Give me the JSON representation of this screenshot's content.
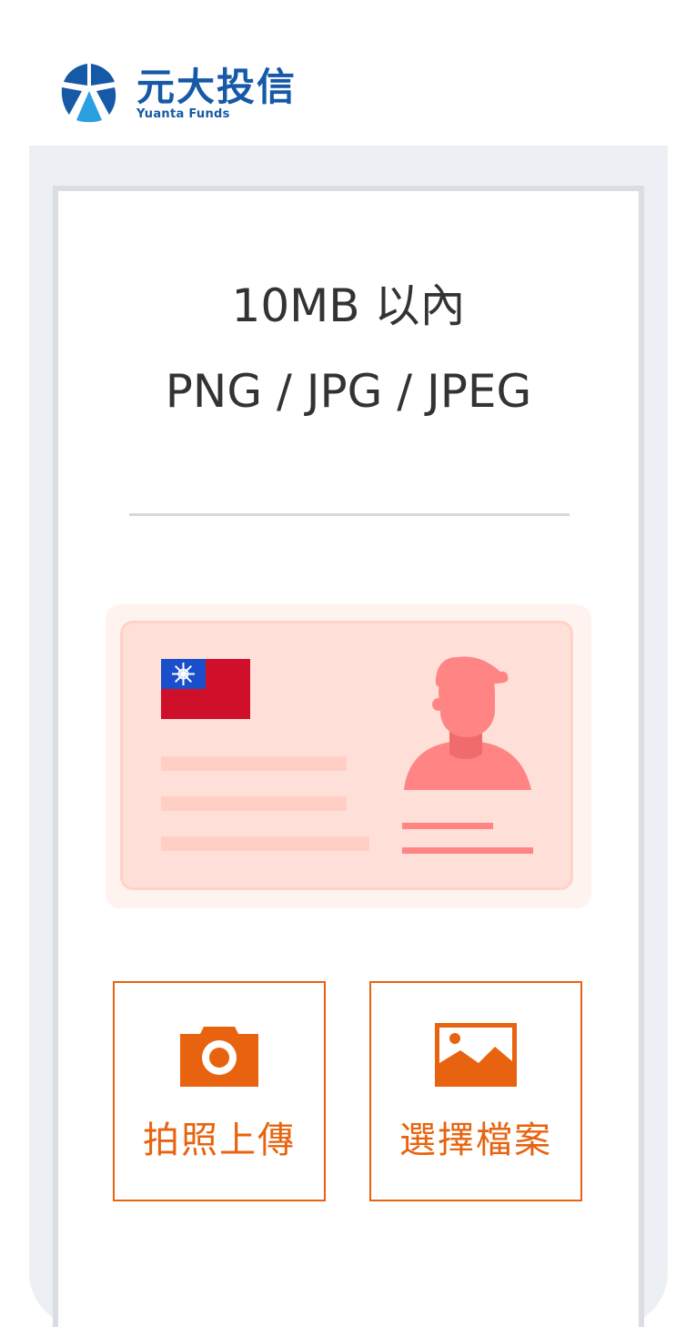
{
  "brand": {
    "name_cn": "元大投信",
    "name_en": "Yuanta Funds",
    "color": "#1659a6",
    "icon": "yuanta-logo-icon"
  },
  "upload": {
    "size_limit": "10MB 以內",
    "file_types": "PNG / JPG / JPEG",
    "id_card_illustration": {
      "icon": "id-card-icon",
      "flag_icon": "taiwan-flag-icon",
      "avatar_icon": "person-avatar-icon"
    }
  },
  "actions": {
    "camera": {
      "label": "拍照上傳",
      "icon": "camera-icon"
    },
    "file": {
      "label": "選擇檔案",
      "icon": "image-icon"
    }
  },
  "colors": {
    "accent": "#e8630f",
    "card_bg": "#ffe0d9",
    "avatar": "#ff8585",
    "flag_red": "#d0102a",
    "flag_blue": "#1a4fcc"
  }
}
